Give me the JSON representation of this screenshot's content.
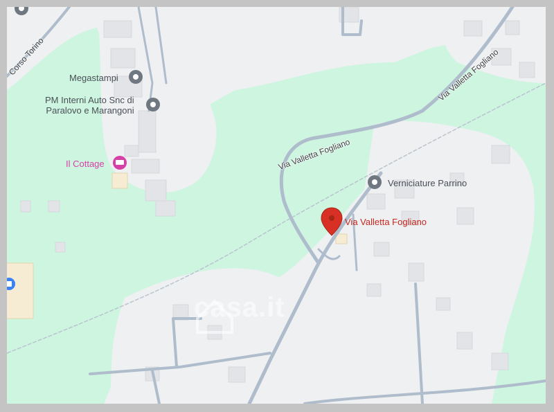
{
  "map": {
    "streets": {
      "corso_torino": "Corso Torino",
      "via_valletta_fogliano_top": "Via Valletta Fogliano",
      "via_valletta_fogliano_mid": "Via Valletta Fogliano"
    },
    "pois": {
      "megastampi": "Megastampi",
      "pm_interni": "PM Interni Auto Snc di\nParalovo e Marangoni",
      "il_cottage": "Il Cottage",
      "verniciature_parrino": "Verniciature Parrino"
    },
    "pin": {
      "label": "Via Valletta Fogliano",
      "color": "#d93025"
    },
    "watermark": "casa.it",
    "colors": {
      "green_area": "#cdf5e0",
      "land": "#eef0f2",
      "roads": "#aebccb",
      "poi_pink": "#d63fa6"
    }
  }
}
